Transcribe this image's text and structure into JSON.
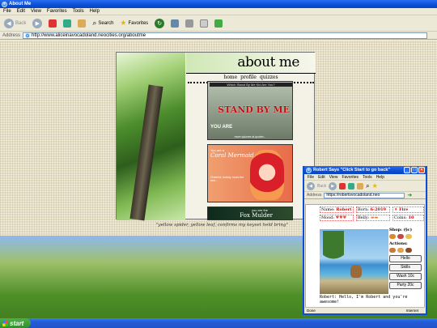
{
  "ie": {
    "title": "About Me",
    "menu": [
      "File",
      "Edit",
      "View",
      "Favorites",
      "Tools",
      "Help"
    ],
    "toolbar": {
      "back": "Back",
      "search": "Search",
      "favorites": "Favorites"
    },
    "address_label": "Address",
    "address": "http://www.aliceinavocadoland.neocities.org/aboutme"
  },
  "page": {
    "heading": "about me",
    "nav": [
      "home",
      "profile",
      "quizzes"
    ],
    "quiz1": {
      "banner": "Which Stand By Me Kid Are You?",
      "title": "STAND BY ME",
      "youare": "YOU ARE",
      "foot": "more quizzes at quotev..."
    },
    "quiz2": {
      "label": "You are a",
      "name": "Coral Mermaid",
      "desc": "Cheerful, bubbly, loves the sea..."
    },
    "quiz3": {
      "line1": "you are the",
      "line2": "Fox Mulder"
    },
    "caption": "\"yellow spider, yellow leaf, confirms my keyset held bring\""
  },
  "popup": {
    "title": "Robert Says \"Click Start to go back\"",
    "menu": [
      "File",
      "Edit",
      "View",
      "Favorites",
      "Tools",
      "Help"
    ],
    "address": "https://robertsvocadoland.neo",
    "stats": {
      "name_label": "Name:",
      "name": "Robert",
      "born_label": "Born:",
      "born": "6-2019",
      "fire_label": "Fire",
      "mood_label": "Mood:",
      "belly_label": "Belly:",
      "coins_label": "Coins:",
      "coins": "10",
      "shop_label": "Shop: (§c)"
    },
    "actions_title": "Actions:",
    "buttons": [
      "Hello",
      "Skills",
      "Wash 10c",
      "Party 20c"
    ],
    "speech": "Robert: Hello, I'm Robert and you're awesome!",
    "status_left": "Done",
    "status_right": "Internet"
  },
  "taskbar": {
    "start": "start"
  }
}
